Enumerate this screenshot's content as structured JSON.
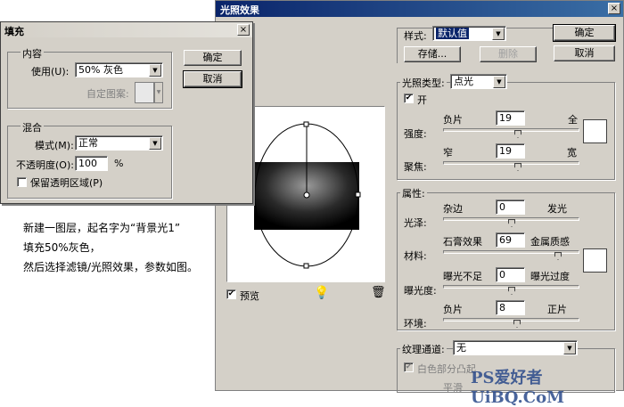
{
  "lighting": {
    "title": "光照效果",
    "close": "×",
    "style_label": "样式:",
    "style_value": "默认值",
    "save": "存储...",
    "delete": "删除",
    "ok": "确定",
    "cancel": "取消",
    "light_type_label": "光照类型:",
    "light_type_value": "点光",
    "on_label": "开",
    "intensity_label": "强度:",
    "intensity_min": "负片",
    "intensity_max": "全",
    "intensity_value": "19",
    "focus_label": "聚焦:",
    "focus_min": "窄",
    "focus_max": "宽",
    "focus_value": "19",
    "properties_label": "属性:",
    "gloss_label": "光泽:",
    "gloss_min": "杂边",
    "gloss_max": "发光",
    "gloss_value": "0",
    "material_label": "材料:",
    "material_min": "石膏效果",
    "material_max": "金属质感",
    "material_value": "69",
    "exposure_label": "曝光度:",
    "exposure_min": "曝光不足",
    "exposure_max": "曝光过度",
    "exposure_value": "0",
    "ambience_label": "环境:",
    "ambience_min": "负片",
    "ambience_max": "正片",
    "ambience_value": "8",
    "texture_label": "纹理通道:",
    "texture_value": "无",
    "white_high_label": "白色部分凸起",
    "height_label": "平滑",
    "preview_label": "预览",
    "light_icon": "lightbulb-icon",
    "trash_icon": "trash-icon",
    "sliders": {
      "intensity": 0.55,
      "focus": 0.55,
      "gloss": 0.5,
      "material": 0.84,
      "exposure": 0.5,
      "ambience": 0.54
    }
  },
  "fill": {
    "title": "填充",
    "close": "×",
    "contents_label": "内容",
    "use_label": "使用(U):",
    "use_value": "50% 灰色",
    "custom_pattern_label": "自定图案:",
    "ok": "确定",
    "cancel": "取消",
    "blending_label": "混合",
    "mode_label": "模式(M):",
    "mode_value": "正常",
    "opacity_label": "不透明度(O):",
    "opacity_value": "100",
    "opacity_unit": "%",
    "preserve_label": "保留透明区域(P)"
  },
  "note": {
    "line1": "新建一图层，起名字为“背景光1”",
    "line2": "填充50%灰色，",
    "line3": "然后选择滤镜/光照效果，参数如图。"
  },
  "watermark": "PS爱好者 UiBQ.CoM"
}
